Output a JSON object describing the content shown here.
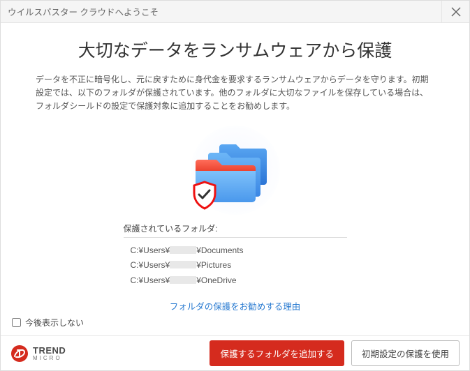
{
  "titlebar": {
    "title": "ウイルスバスター クラウドへようこそ"
  },
  "main": {
    "heading": "大切なデータをランサムウェアから保護",
    "description": "データを不正に暗号化し、元に戻すために身代金を要求するランサムウェアからデータを守ります。初期設定では、以下のフォルダが保護されています。他のフォルダに大切なファイルを保存している場合は、フォルダシールドの設定で保護対象に追加することをお勧めします。"
  },
  "protected": {
    "label": "保護されているフォルダ:",
    "folders": [
      {
        "prefix": "C:¥Users¥",
        "suffix": "¥Documents"
      },
      {
        "prefix": "C:¥Users¥",
        "suffix": "¥Pictures"
      },
      {
        "prefix": "C:¥Users¥",
        "suffix": "¥OneDrive"
      }
    ]
  },
  "why_link": "フォルダの保護をお勧めする理由",
  "dont_show_label": "今後表示しない",
  "brand": {
    "name": "TREND",
    "sub": "MICRO"
  },
  "buttons": {
    "primary": "保護するフォルダを追加する",
    "secondary": "初期設定の保護を使用"
  },
  "colors": {
    "accent": "#d52b1e",
    "link": "#2a7bd1"
  }
}
